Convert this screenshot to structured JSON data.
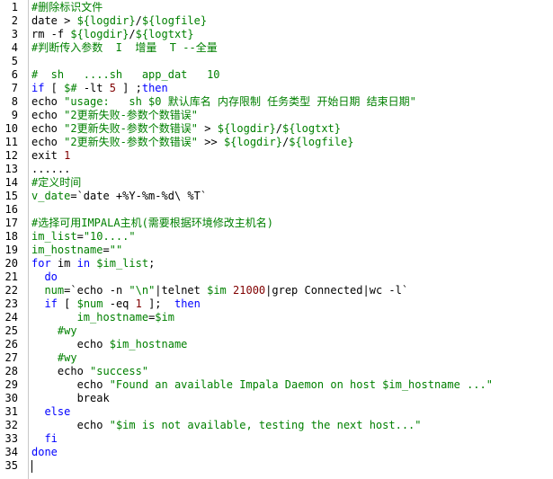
{
  "editor": {
    "lines": [
      [
        [
          "cmt",
          "#删除标识文件"
        ]
      ],
      [
        [
          "plain",
          "date > "
        ],
        [
          "var",
          "${logdir}"
        ],
        [
          "plain",
          "/"
        ],
        [
          "var",
          "${logfile}"
        ]
      ],
      [
        [
          "plain",
          "rm -f "
        ],
        [
          "var",
          "${logdir}"
        ],
        [
          "plain",
          "/"
        ],
        [
          "var",
          "${logtxt}"
        ]
      ],
      [
        [
          "cmt",
          "#判断传入参数  I  增量  T --全量"
        ]
      ],
      [
        [
          "plain",
          ""
        ]
      ],
      [
        [
          "cmt",
          "#  sh   ....sh   app_dat   10"
        ]
      ],
      [
        [
          "kw",
          "if"
        ],
        [
          "plain",
          " [ "
        ],
        [
          "var",
          "$#"
        ],
        [
          "plain",
          " -lt "
        ],
        [
          "num",
          "5"
        ],
        [
          "plain",
          " ] ;"
        ],
        [
          "kw",
          "then"
        ]
      ],
      [
        [
          "plain",
          "echo "
        ],
        [
          "str",
          "\"usage:   sh "
        ],
        [
          "var",
          "$0"
        ],
        [
          "str",
          " 默认库名 内存限制 任务类型 开始日期 结束日期\""
        ]
      ],
      [
        [
          "plain",
          "echo "
        ],
        [
          "str",
          "\"2更新失败-参数个数错误\""
        ]
      ],
      [
        [
          "plain",
          "echo "
        ],
        [
          "str",
          "\"2更新失败-参数个数错误\""
        ],
        [
          "plain",
          " > "
        ],
        [
          "var",
          "${logdir}"
        ],
        [
          "plain",
          "/"
        ],
        [
          "var",
          "${logtxt}"
        ]
      ],
      [
        [
          "plain",
          "echo "
        ],
        [
          "str",
          "\"2更新失败-参数个数错误\""
        ],
        [
          "plain",
          " >> "
        ],
        [
          "var",
          "${logdir}"
        ],
        [
          "plain",
          "/"
        ],
        [
          "var",
          "${logfile}"
        ]
      ],
      [
        [
          "plain",
          "exit "
        ],
        [
          "num",
          "1"
        ]
      ],
      [
        [
          "plain",
          "......"
        ]
      ],
      [
        [
          "cmt",
          "#定义时间"
        ]
      ],
      [
        [
          "var",
          "v_date"
        ],
        [
          "plain",
          "=`date +%Y-%m-%d\\ %T`"
        ]
      ],
      [
        [
          "plain",
          ""
        ]
      ],
      [
        [
          "cmt",
          "#选择可用IMPALA主机(需要根据环境修改主机名)"
        ]
      ],
      [
        [
          "var",
          "im_list"
        ],
        [
          "plain",
          "="
        ],
        [
          "str",
          "\"10....\""
        ]
      ],
      [
        [
          "var",
          "im_hostname"
        ],
        [
          "plain",
          "="
        ],
        [
          "str",
          "\"\""
        ]
      ],
      [
        [
          "kw",
          "for"
        ],
        [
          "plain",
          " im "
        ],
        [
          "kw",
          "in"
        ],
        [
          "plain",
          " "
        ],
        [
          "var",
          "$im_list"
        ],
        [
          "plain",
          ";"
        ]
      ],
      [
        [
          "plain",
          "  "
        ],
        [
          "kw",
          "do"
        ]
      ],
      [
        [
          "plain",
          "  "
        ],
        [
          "var",
          "num"
        ],
        [
          "plain",
          "=`echo -n "
        ],
        [
          "str",
          "\"\\n\""
        ],
        [
          "plain",
          "|telnet "
        ],
        [
          "var",
          "$im"
        ],
        [
          "plain",
          " "
        ],
        [
          "num",
          "21000"
        ],
        [
          "plain",
          "|grep Connected|wc -l`"
        ]
      ],
      [
        [
          "plain",
          "  "
        ],
        [
          "kw",
          "if"
        ],
        [
          "plain",
          " [ "
        ],
        [
          "var",
          "$num"
        ],
        [
          "plain",
          " -eq "
        ],
        [
          "num",
          "1"
        ],
        [
          "plain",
          " ];  "
        ],
        [
          "kw",
          "then"
        ]
      ],
      [
        [
          "plain",
          "       "
        ],
        [
          "var",
          "im_hostname"
        ],
        [
          "plain",
          "="
        ],
        [
          "var",
          "$im"
        ]
      ],
      [
        [
          "plain",
          "    "
        ],
        [
          "cmt",
          "#wy"
        ]
      ],
      [
        [
          "plain",
          "       echo "
        ],
        [
          "var",
          "$im_hostname"
        ]
      ],
      [
        [
          "plain",
          "    "
        ],
        [
          "cmt",
          "#wy"
        ]
      ],
      [
        [
          "plain",
          "    echo "
        ],
        [
          "str",
          "\"success\""
        ]
      ],
      [
        [
          "plain",
          "       echo "
        ],
        [
          "str",
          "\"Found an available Impala Daemon on host "
        ],
        [
          "var",
          "$im_hostname"
        ],
        [
          "str",
          " ...\""
        ]
      ],
      [
        [
          "plain",
          "       break"
        ]
      ],
      [
        [
          "plain",
          "  "
        ],
        [
          "kw",
          "else"
        ]
      ],
      [
        [
          "plain",
          "       echo "
        ],
        [
          "str",
          "\""
        ],
        [
          "var",
          "$im"
        ],
        [
          "str",
          " is not available, testing the next host...\""
        ]
      ],
      [
        [
          "plain",
          "  "
        ],
        [
          "kw",
          "fi"
        ]
      ],
      [
        [
          "kw",
          "done"
        ]
      ],
      [
        [
          "plain",
          ""
        ]
      ]
    ]
  }
}
